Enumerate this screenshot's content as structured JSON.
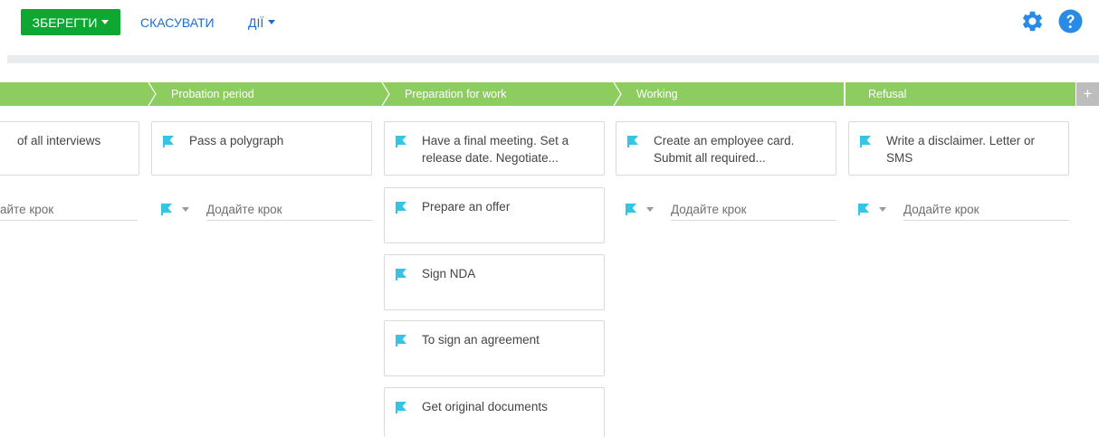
{
  "toolbar": {
    "save_label": "ЗБЕРЕГТИ",
    "cancel_label": "СКАСУВАТИ",
    "actions_label": "ДІЇ"
  },
  "colors": {
    "save_green": "#0ea732",
    "link_blue": "#1f6ecf",
    "stage_green": "#8dcd5f",
    "flag_cyan": "#33c4e6",
    "icon_blue": "#2a8be6"
  },
  "icons": {
    "settings": "gear-icon",
    "help": "question-icon",
    "step": "flag-icon"
  },
  "stages": [
    {
      "label": ""
    },
    {
      "label": "Probation period"
    },
    {
      "label": "Preparation for work"
    },
    {
      "label": "Working"
    },
    {
      "label": "Refusal"
    }
  ],
  "add_stage_label": "+",
  "columns": [
    {
      "cards": [
        {
          "title": "of all interviews"
        }
      ],
      "add_step_placeholder": "айте крок"
    },
    {
      "cards": [
        {
          "title": "Pass a polygraph"
        }
      ],
      "add_step_placeholder": "Додайте крок"
    },
    {
      "cards": [
        {
          "title": "Have a final meeting. Set a release date. Negotiate..."
        },
        {
          "title": "Prepare an offer"
        },
        {
          "title": "Sign NDA"
        },
        {
          "title": "To sign an agreement"
        },
        {
          "title": "Get original documents"
        }
      ]
    },
    {
      "cards": [
        {
          "title": "Create an employee card. Submit all required..."
        }
      ],
      "add_step_placeholder": "Додайте крок"
    },
    {
      "cards": [
        {
          "title": "Write a disclaimer. Letter or SMS"
        }
      ],
      "add_step_placeholder": "Додайте крок"
    }
  ]
}
